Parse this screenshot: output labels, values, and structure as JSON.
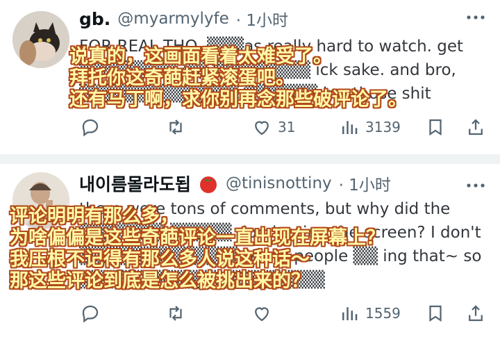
{
  "tweets": [
    {
      "name": "gb.",
      "handle": "@myarmylyfe",
      "time": "· 1小时",
      "body_visible": "FOR REAL THO. ▒▒▒as really hard to watch. get\n▒▒▒▒▒▒▒▒ ▒▒ ▒▒▒▒▒▒▒▒ ick sake. and bro,\n▒▒▒▒▒▒▒▒▒▒▒▒▒ ▒▒▒▒▒▒ ing those shit",
      "overlay": "说真的，这画面看着太难受了。\n拜托你这奇葩赶紧滚蛋吧。\n还有马丁啊，求你别再念那些破评论了。",
      "actions": {
        "replies": "",
        "retweets": "",
        "likes": "31",
        "views": "3139"
      }
    },
    {
      "name": "내이름몰라도됩",
      "handle": "@tinisnottiny",
      "time": "· 1小时",
      "body_visible": "there were tons of comments, but why did the\n▒▒▒▒▒▒▒ ▒▒▒▒▒ dominating the screen? I don't\n▒▒▒▒▒▒▒▒▒▒▒▒▒ many people ▒▒ ing that~ so\n▒▒▒▒▒▒▒▒▒▒▒▒▒▒▒▒▒▒▒▒",
      "overlay": "评论明明有那么多，\n为啥偏偏是这些奇葩评论一直出现在屏幕上？\n我压根不记得有那么多人说这种话～\n那这些评论到底是怎么被挑出来的？",
      "actions": {
        "replies": "",
        "retweets": "",
        "likes": "",
        "views": "1559"
      }
    }
  ],
  "colors": {
    "icon_gray": "#536471",
    "divider": "#eff3f4",
    "overlay_fill": "#fff9a8",
    "overlay_stroke": "#b24a1a"
  },
  "icons": [
    "more-icon",
    "reply-icon",
    "retweet-icon",
    "like-icon",
    "views-icon",
    "bookmark-icon",
    "share-icon",
    "tomato-emoji"
  ]
}
